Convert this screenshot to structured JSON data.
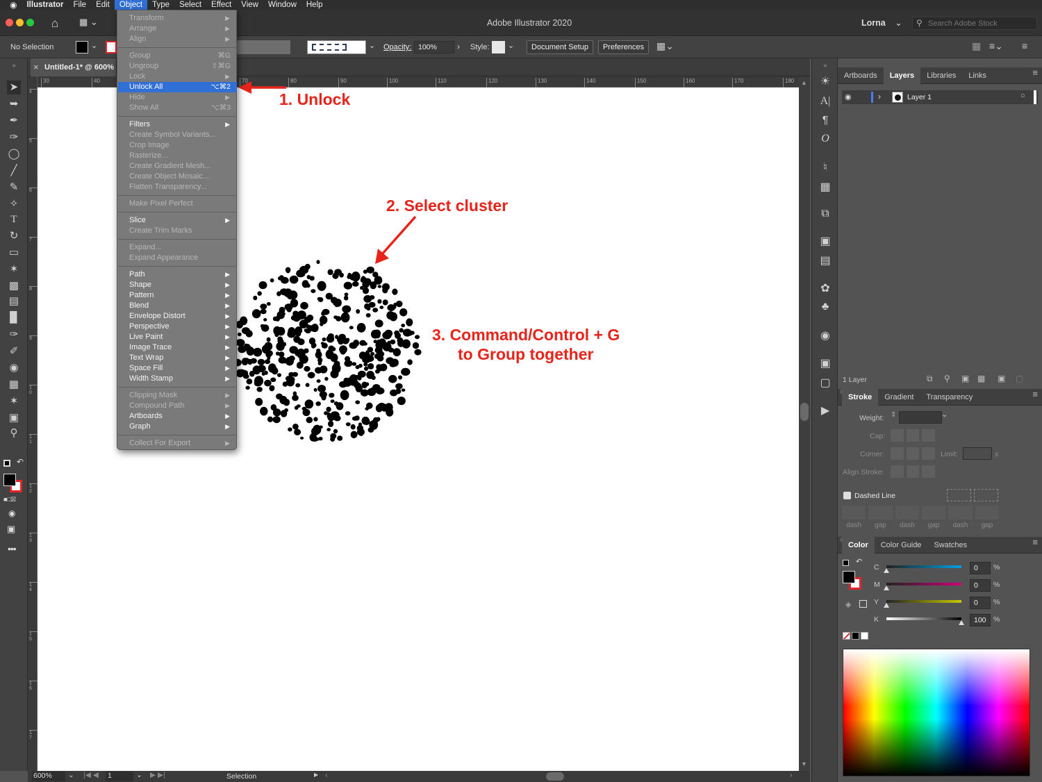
{
  "menubar": {
    "apple": "",
    "app": "Illustrator",
    "items": [
      "File",
      "Edit",
      "Object",
      "Type",
      "Select",
      "Effect",
      "View",
      "Window",
      "Help"
    ]
  },
  "titlebar": {
    "title": "Adobe Illustrator 2020",
    "user": "Lorna",
    "search_placeholder": "Search Adobe Stock"
  },
  "control": {
    "selection": "No Selection",
    "opacity_label": "Opacity:",
    "opacity_value": "100%",
    "style_label": "Style:",
    "document_setup": "Document Setup",
    "preferences": "Preferences"
  },
  "document_tab": {
    "title": "Untitled-1* @ 600% (",
    "close": "×"
  },
  "ruler": {
    "top_ticks": [
      "30",
      "40",
      "70",
      "80",
      "90",
      "100",
      "110",
      "120",
      "130",
      "140",
      "150",
      "160",
      "170",
      "180"
    ],
    "left_ticks": [
      "4",
      "5",
      "6",
      "7",
      "8",
      "9",
      "1\n0",
      "1\n1",
      "1\n2",
      "1\n3",
      "1\n4",
      "1\n5",
      "1\n6",
      "1\n7"
    ]
  },
  "status": {
    "zoom": "600%",
    "page": "1",
    "mode": "Selection"
  },
  "object_menu": {
    "items": [
      {
        "label": "Transform",
        "shortcut": "",
        "submenu": true,
        "enabled": false
      },
      {
        "label": "Arrange",
        "shortcut": "",
        "submenu": true,
        "enabled": false
      },
      {
        "label": "Align",
        "shortcut": "",
        "submenu": true,
        "enabled": false
      },
      {
        "sep": true
      },
      {
        "label": "Group",
        "shortcut": "⌘G",
        "submenu": false,
        "enabled": false
      },
      {
        "label": "Ungroup",
        "shortcut": "⇧⌘G",
        "submenu": false,
        "enabled": false
      },
      {
        "label": "Lock",
        "shortcut": "",
        "submenu": true,
        "enabled": false
      },
      {
        "label": "Unlock All",
        "shortcut": "⌥⌘2",
        "submenu": false,
        "enabled": true,
        "highlight": true
      },
      {
        "label": "Hide",
        "shortcut": "",
        "submenu": true,
        "enabled": false
      },
      {
        "label": "Show All",
        "shortcut": "⌥⌘3",
        "submenu": false,
        "enabled": false
      },
      {
        "sep": true
      },
      {
        "label": "Filters",
        "shortcut": "",
        "submenu": true,
        "enabled": true
      },
      {
        "label": "Create Symbol Variants...",
        "shortcut": "",
        "submenu": false,
        "enabled": false
      },
      {
        "label": "Crop Image",
        "shortcut": "",
        "submenu": false,
        "enabled": false
      },
      {
        "label": "Rasterize...",
        "shortcut": "",
        "submenu": false,
        "enabled": false
      },
      {
        "label": "Create Gradient Mesh...",
        "shortcut": "",
        "submenu": false,
        "enabled": false
      },
      {
        "label": "Create Object Mosaic...",
        "shortcut": "",
        "submenu": false,
        "enabled": false
      },
      {
        "label": "Flatten Transparency...",
        "shortcut": "",
        "submenu": false,
        "enabled": false
      },
      {
        "sep": true
      },
      {
        "label": "Make Pixel Perfect",
        "shortcut": "",
        "submenu": false,
        "enabled": false
      },
      {
        "sep": true
      },
      {
        "label": "Slice",
        "shortcut": "",
        "submenu": true,
        "enabled": true
      },
      {
        "label": "Create Trim Marks",
        "shortcut": "",
        "submenu": false,
        "enabled": false
      },
      {
        "sep": true
      },
      {
        "label": "Expand...",
        "shortcut": "",
        "submenu": false,
        "enabled": false
      },
      {
        "label": "Expand Appearance",
        "shortcut": "",
        "submenu": false,
        "enabled": false
      },
      {
        "sep": true
      },
      {
        "label": "Path",
        "shortcut": "",
        "submenu": true,
        "enabled": true
      },
      {
        "label": "Shape",
        "shortcut": "",
        "submenu": true,
        "enabled": true
      },
      {
        "label": "Pattern",
        "shortcut": "",
        "submenu": true,
        "enabled": true
      },
      {
        "label": "Blend",
        "shortcut": "",
        "submenu": true,
        "enabled": true
      },
      {
        "label": "Envelope Distort",
        "shortcut": "",
        "submenu": true,
        "enabled": true
      },
      {
        "label": "Perspective",
        "shortcut": "",
        "submenu": true,
        "enabled": true
      },
      {
        "label": "Live Paint",
        "shortcut": "",
        "submenu": true,
        "enabled": true
      },
      {
        "label": "Image Trace",
        "shortcut": "",
        "submenu": true,
        "enabled": true
      },
      {
        "label": "Text Wrap",
        "shortcut": "",
        "submenu": true,
        "enabled": true
      },
      {
        "label": "Space Fill",
        "shortcut": "",
        "submenu": true,
        "enabled": true
      },
      {
        "label": "Width Stamp",
        "shortcut": "",
        "submenu": true,
        "enabled": true
      },
      {
        "sep": true
      },
      {
        "label": "Clipping Mask",
        "shortcut": "",
        "submenu": true,
        "enabled": false
      },
      {
        "label": "Compound Path",
        "shortcut": "",
        "submenu": true,
        "enabled": false
      },
      {
        "label": "Artboards",
        "shortcut": "",
        "submenu": true,
        "enabled": true
      },
      {
        "label": "Graph",
        "shortcut": "",
        "submenu": true,
        "enabled": true
      },
      {
        "sep": true
      },
      {
        "label": "Collect For Export",
        "shortcut": "",
        "submenu": true,
        "enabled": false
      }
    ]
  },
  "annotations": {
    "step1": "1. Unlock",
    "step2": "2. Select cluster",
    "step3_line1": "3. Command/Control + G",
    "step3_line2": "to Group together",
    "color": "#e8231a"
  },
  "layers_panel": {
    "tabs": [
      "Artboards",
      "Layers",
      "Libraries",
      "Links"
    ],
    "active_tab": "Layers",
    "layer_name": "Layer 1",
    "footer": "1 Layer"
  },
  "stroke_panel": {
    "tabs": [
      "Stroke",
      "Gradient",
      "Transparency"
    ],
    "weight_label": "Weight:",
    "cap_label": "Cap:",
    "corner_label": "Corner:",
    "limit_label": "Limit:",
    "limit_unit": "x",
    "align_label": "Align Stroke:",
    "dashed_label": "Dashed Line",
    "dash_labels": [
      "dash",
      "gap",
      "dash",
      "gap",
      "dash",
      "gap"
    ]
  },
  "color_panel": {
    "tabs": [
      "Color",
      "Color Guide",
      "Swatches"
    ],
    "channels": [
      {
        "name": "C",
        "value": "0",
        "unit": "%"
      },
      {
        "name": "M",
        "value": "0",
        "unit": "%"
      },
      {
        "name": "Y",
        "value": "0",
        "unit": "%"
      },
      {
        "name": "K",
        "value": "100",
        "unit": "%"
      }
    ]
  }
}
